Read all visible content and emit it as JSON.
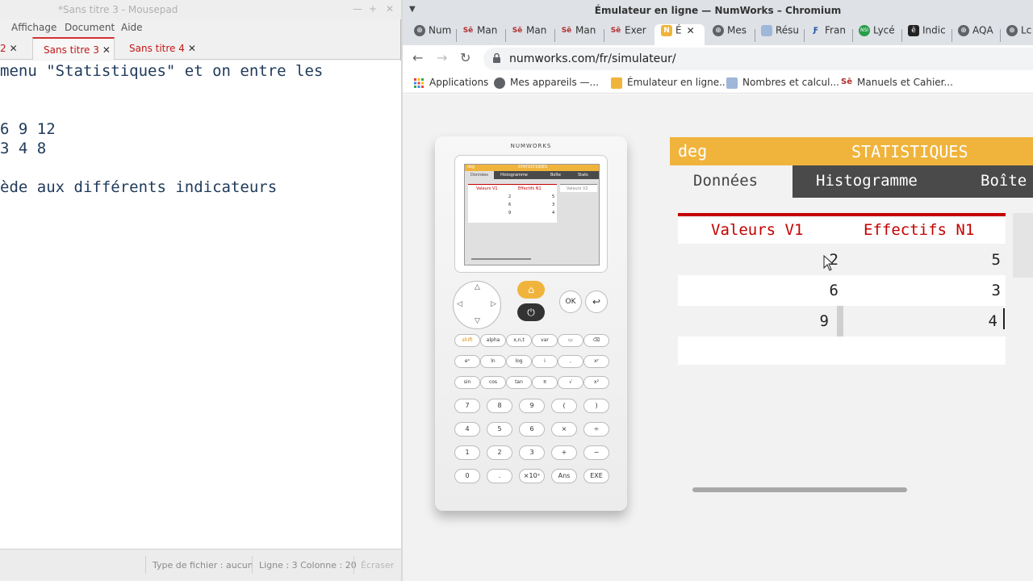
{
  "mousepad": {
    "title": "*Sans titre 3 - Mousepad",
    "window_buttons": [
      "—",
      "+",
      "✕"
    ],
    "menus": [
      "Affichage",
      "Document",
      "Aide"
    ],
    "tabs": [
      {
        "label": "2",
        "active": false
      },
      {
        "label": "Sans titre 3",
        "active": true
      },
      {
        "label": "Sans titre 4",
        "active": false
      }
    ],
    "lines": [
      "menu \"Statistiques\" et on entre les",
      "",
      "",
      "6 9 12",
      "3 4 8",
      "",
      "ède aux différents indicateurs"
    ],
    "status": {
      "filetype": "Type de fichier : aucun",
      "position": "Ligne : 3 Colonne : 20",
      "mode": "Écraser"
    }
  },
  "chromium": {
    "title": "Émulateur en ligne — NumWorks – Chromium",
    "tabs": [
      {
        "label": "Num",
        "icon": "globe-icon"
      },
      {
        "label": "Man",
        "icon": "sesamath-icon"
      },
      {
        "label": "Man",
        "icon": "sesamath-icon"
      },
      {
        "label": "Man",
        "icon": "sesamath-icon"
      },
      {
        "label": "Exer",
        "icon": "sesamath-icon"
      },
      {
        "label": "É",
        "icon": "numworks-icon",
        "active": true
      },
      {
        "label": "Mes",
        "icon": "globe-icon"
      },
      {
        "label": "Résu",
        "icon": "page-icon"
      },
      {
        "label": "Fran",
        "icon": "fr-icon"
      },
      {
        "label": "Lycé",
        "icon": "nsi-icon"
      },
      {
        "label": "Indic",
        "icon": "e-icon"
      },
      {
        "label": "AQA",
        "icon": "globe-icon"
      },
      {
        "label": "Lc",
        "icon": "globe-icon"
      }
    ],
    "url": "numworks.com/fr/simulateur/",
    "bookmarks": [
      {
        "label": "Applications",
        "icon": "apps-grid-icon"
      },
      {
        "label": "Mes appareils —...",
        "icon": "globe-icon"
      },
      {
        "label": "Émulateur en ligne...",
        "icon": "numworks-icon"
      },
      {
        "label": "Nombres et calcul...",
        "icon": "page-icon"
      },
      {
        "label": "Manuels et Cahier...",
        "icon": "sesamath-icon"
      }
    ]
  },
  "calculator": {
    "brand": "NUMWORKS",
    "mini_screen": {
      "angle": "deg",
      "title": "STATISTIQUES",
      "tabs": [
        "Données",
        "Histogramme",
        "Boîte",
        "Stats"
      ],
      "col_heads": [
        "Valeurs V1",
        "Effectifs N1",
        "Valeurs V2"
      ],
      "v1": [
        "2",
        "6",
        "9"
      ],
      "n1": [
        "5",
        "3",
        "4"
      ]
    },
    "keys_top": [
      "OK"
    ],
    "rows": [
      [
        "shift",
        "alpha",
        "x,n,t",
        "var",
        "",
        ""
      ],
      [
        "eˣ",
        "ln",
        "log",
        "i",
        ",",
        "xʸ"
      ],
      [
        "sin",
        "cos",
        "tan",
        "π",
        "√",
        "x²"
      ],
      [
        "7",
        "8",
        "9",
        "(",
        ")"
      ],
      [
        "4",
        "5",
        "6",
        "×",
        "÷"
      ],
      [
        "1",
        "2",
        "3",
        "+",
        "−"
      ],
      [
        "0",
        ".",
        "×10ˣ",
        "Ans",
        "EXE"
      ]
    ]
  },
  "numworks": {
    "angle_unit": "deg",
    "app_title": "STATISTIQUES",
    "tabs": [
      "Données",
      "Histogramme",
      "Boîte"
    ],
    "active_tab": "Données",
    "columns": [
      "Valeurs V1",
      "Effectifs N1"
    ],
    "values_v1": [
      "2",
      "6",
      "9"
    ],
    "counts_n1": [
      "5",
      "3",
      "4"
    ],
    "accent_color": "#f0b43c",
    "header_red": "#c40000"
  }
}
